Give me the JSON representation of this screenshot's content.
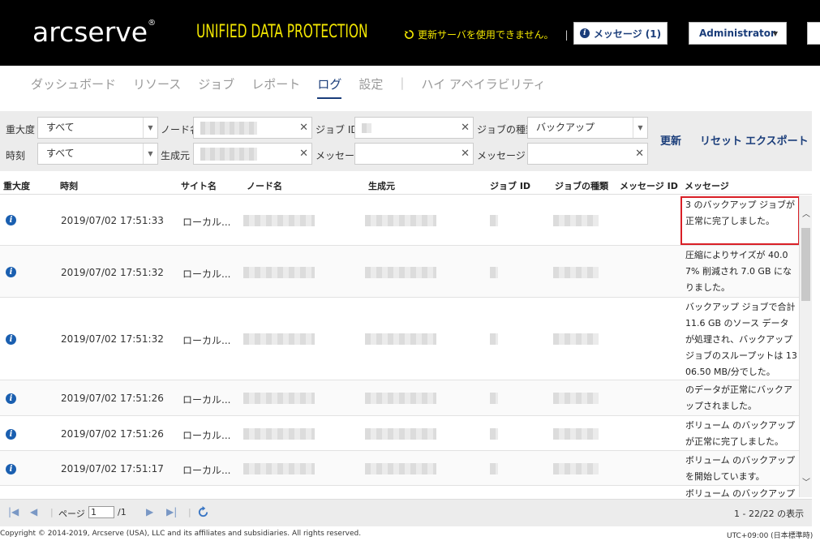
{
  "header": {
    "brand": "arcserve",
    "brand_mark": "®",
    "product": "UNIFIED DATA PROTECTION",
    "update_warning": "更新サーバを使用できません。",
    "messages_button": "メッセージ (1)",
    "user_menu": "Administrator"
  },
  "nav": {
    "tabs": [
      "ダッシュボード",
      "リソース",
      "ジョブ",
      "レポート",
      "ログ",
      "設定"
    ],
    "active": "ログ",
    "extra_tab": "ハイ アベイラビリティ"
  },
  "filters": {
    "severity_label": "重大度",
    "severity_value": "すべて",
    "time_label": "時刻",
    "time_value": "すべて",
    "node_label": "ノード名",
    "generator_label": "生成元",
    "jobid_label": "ジョブ ID",
    "message_label": "メッセージ",
    "jobtype_label": "ジョブの種類",
    "jobtype_value": "バックアップ",
    "messageid_label": "メッセージ ID",
    "refresh": "更新",
    "reset": "リセット",
    "export": "エクスポート"
  },
  "table": {
    "columns": [
      "重大度",
      "時刻",
      "サイト名",
      "ノード名",
      "生成元",
      "ジョブ ID",
      "ジョブの種類",
      "メッセージ ID",
      "メッセージ"
    ],
    "rows": [
      {
        "time": "2019/07/02 17:51:33",
        "site": "ローカル...",
        "message": "         3 のバックアップ ジョブが正常に完了しました。"
      },
      {
        "time": "2019/07/02 17:51:32",
        "site": "ローカル...",
        "message": "圧縮によりサイズが 40.07% 削減され 7.0 GB になりました。"
      },
      {
        "time": "2019/07/02 17:51:32",
        "site": "ローカル...",
        "message": "バックアップ ジョブで合計 11.6 GB のソース データが処理され、バックアップ ジョブのスループットは 1306.50 MB/分でした。"
      },
      {
        "time": "2019/07/02 17:51:26",
        "site": "ローカル...",
        "message": "          のデータが正常にバックアップされました。"
      },
      {
        "time": "2019/07/02 17:51:26",
        "site": "ローカル...",
        "message": "ボリューム        のバックアップが正常に完了しました。"
      },
      {
        "time": "2019/07/02 17:51:17",
        "site": "ローカル...",
        "message": "ボリューム         のバックアップを開始しています。"
      },
      {
        "time": "",
        "site": "",
        "message": "ボリューム         のバックアップ"
      }
    ]
  },
  "pager": {
    "page_label": "ページ",
    "page_value": "1",
    "page_total": "/1",
    "summary": "1 - 22/22 の表示"
  },
  "footer": {
    "copyright": "Copyright © 2014-2019, Arcserve (USA), LLC and its affiliates and subsidiaries. All rights reserved.",
    "timezone": "UTC+09:00 (日本標準時)"
  }
}
